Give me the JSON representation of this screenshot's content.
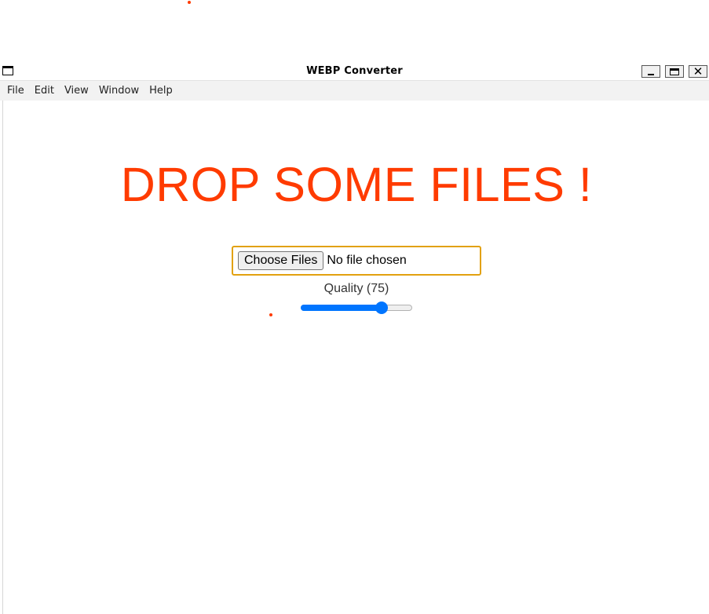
{
  "window": {
    "title": "WEBP Converter"
  },
  "menu": [
    "File",
    "Edit",
    "View",
    "Window",
    "Help"
  ],
  "main": {
    "headline": "DROP SOME FILES !",
    "file_input": {
      "button_label": "Choose Files",
      "status": "No file chosen"
    },
    "quality": {
      "label": "Quality (75)",
      "value": 75,
      "min": 0,
      "max": 100
    }
  },
  "colors": {
    "headline": "#ff3b00",
    "slider_accent": "#0075ff",
    "file_box_border": "#e2a10f"
  }
}
